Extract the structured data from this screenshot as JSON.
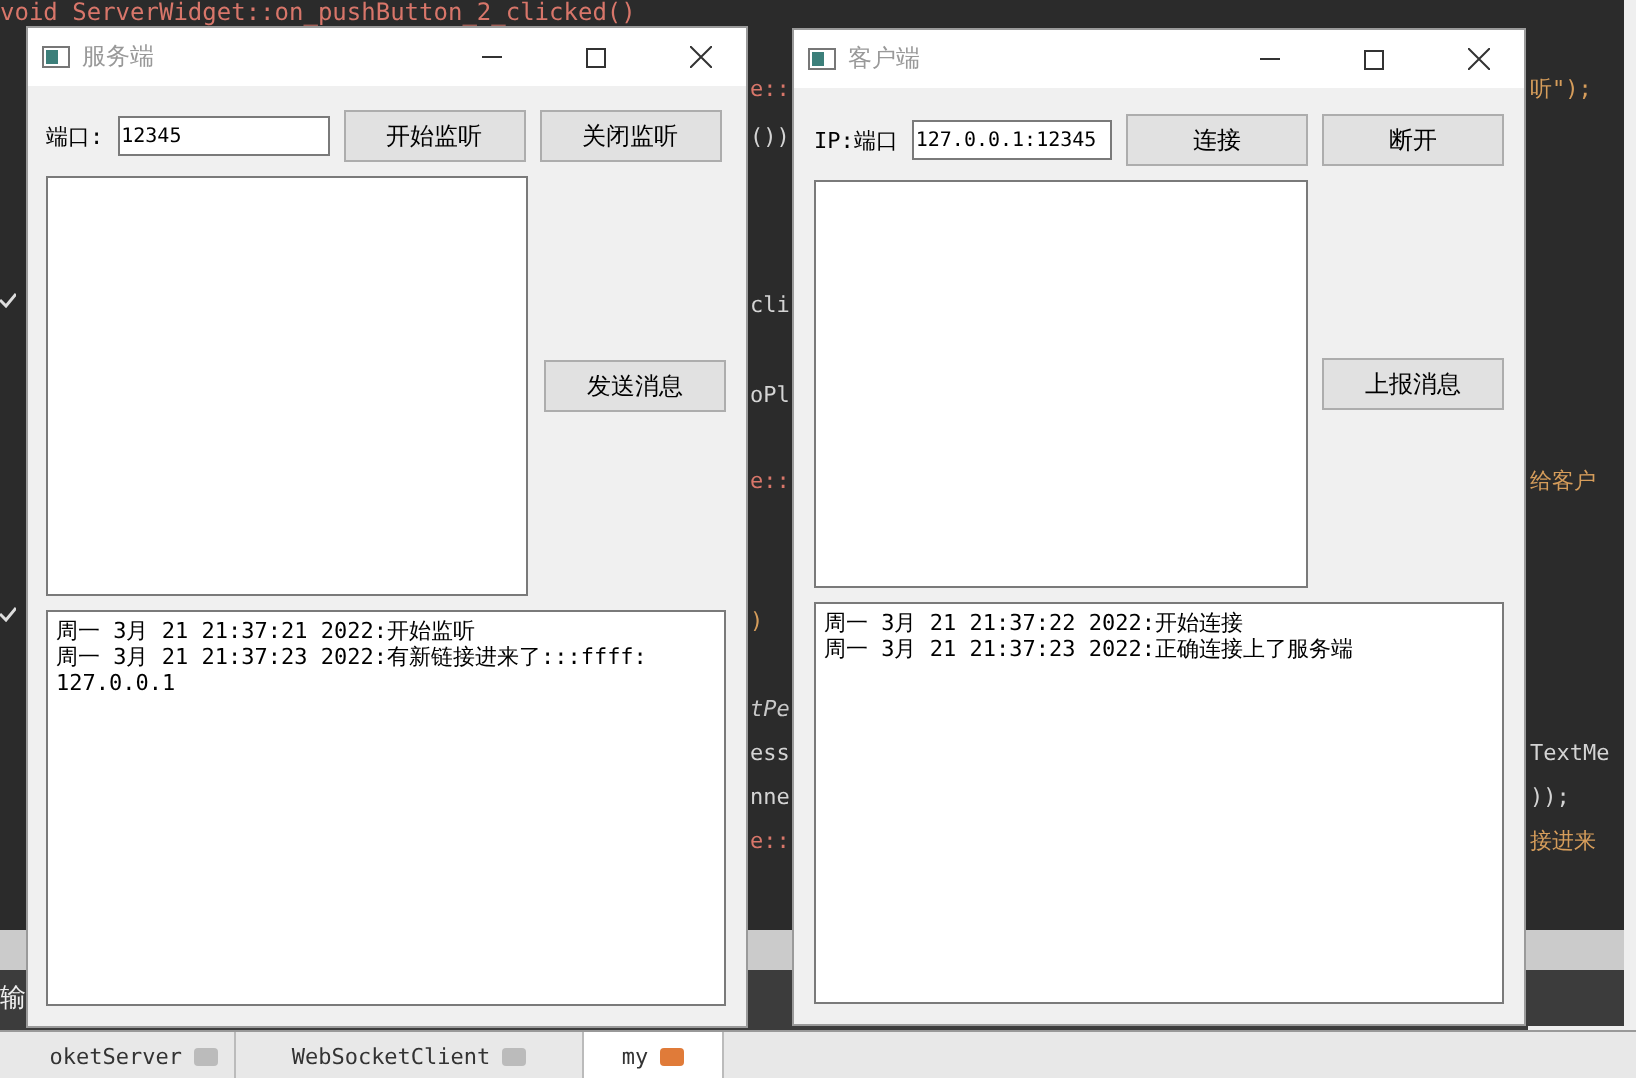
{
  "background_editor": {
    "code_fragments": [
      {
        "text": "void ServerWidget::on_pushButton_2_clicked()",
        "kind": "plain"
      },
      {
        "text": "e::",
        "kind": "keyword"
      },
      {
        "text": "())",
        "kind": "plain"
      },
      {
        "text": "cli",
        "kind": "plain"
      },
      {
        "text": "oPl",
        "kind": "plain"
      },
      {
        "text": "e::",
        "kind": "keyword"
      },
      {
        "text": ")",
        "kind": "string"
      },
      {
        "text": "tPe",
        "kind": "italic"
      },
      {
        "text": "ess",
        "kind": "plain"
      },
      {
        "text": "nne",
        "kind": "plain"
      },
      {
        "text": "e::",
        "kind": "keyword"
      },
      {
        "text": "听\");",
        "kind": "string"
      },
      {
        "text": "给客户",
        "kind": "string"
      },
      {
        "text": "TextMe",
        "kind": "plain"
      },
      {
        "text": "));",
        "kind": "plain"
      },
      {
        "text": "接进来",
        "kind": "string"
      }
    ],
    "output_tab": "输",
    "file_tabs": [
      {
        "label": "oketServer",
        "selected": false
      },
      {
        "label": "WebSocketClient",
        "selected": false
      },
      {
        "label": "my",
        "selected": true
      }
    ]
  },
  "server_window": {
    "title": "服务端",
    "field_label": "端口:",
    "field_value": "12345",
    "buttons": [
      {
        "label": "开始监听"
      },
      {
        "label": "关闭监听"
      }
    ],
    "send_button": "发送消息",
    "log": [
      "周一 3月 21 21:37:21 2022:开始监听",
      "周一 3月 21 21:37:23 2022:有新链接进来了:::ffff:",
      "127.0.0.1"
    ]
  },
  "client_window": {
    "title": "客户端",
    "field_label": "IP:端口",
    "field_value": "127.0.0.1:12345",
    "buttons": [
      {
        "label": "连接"
      },
      {
        "label": "断开"
      }
    ],
    "send_button": "上报消息",
    "log": [
      "周一 3月 21 21:37:22 2022:开始连接",
      "周一 3月 21 21:37:23 2022:正确连接上了服务端"
    ]
  }
}
